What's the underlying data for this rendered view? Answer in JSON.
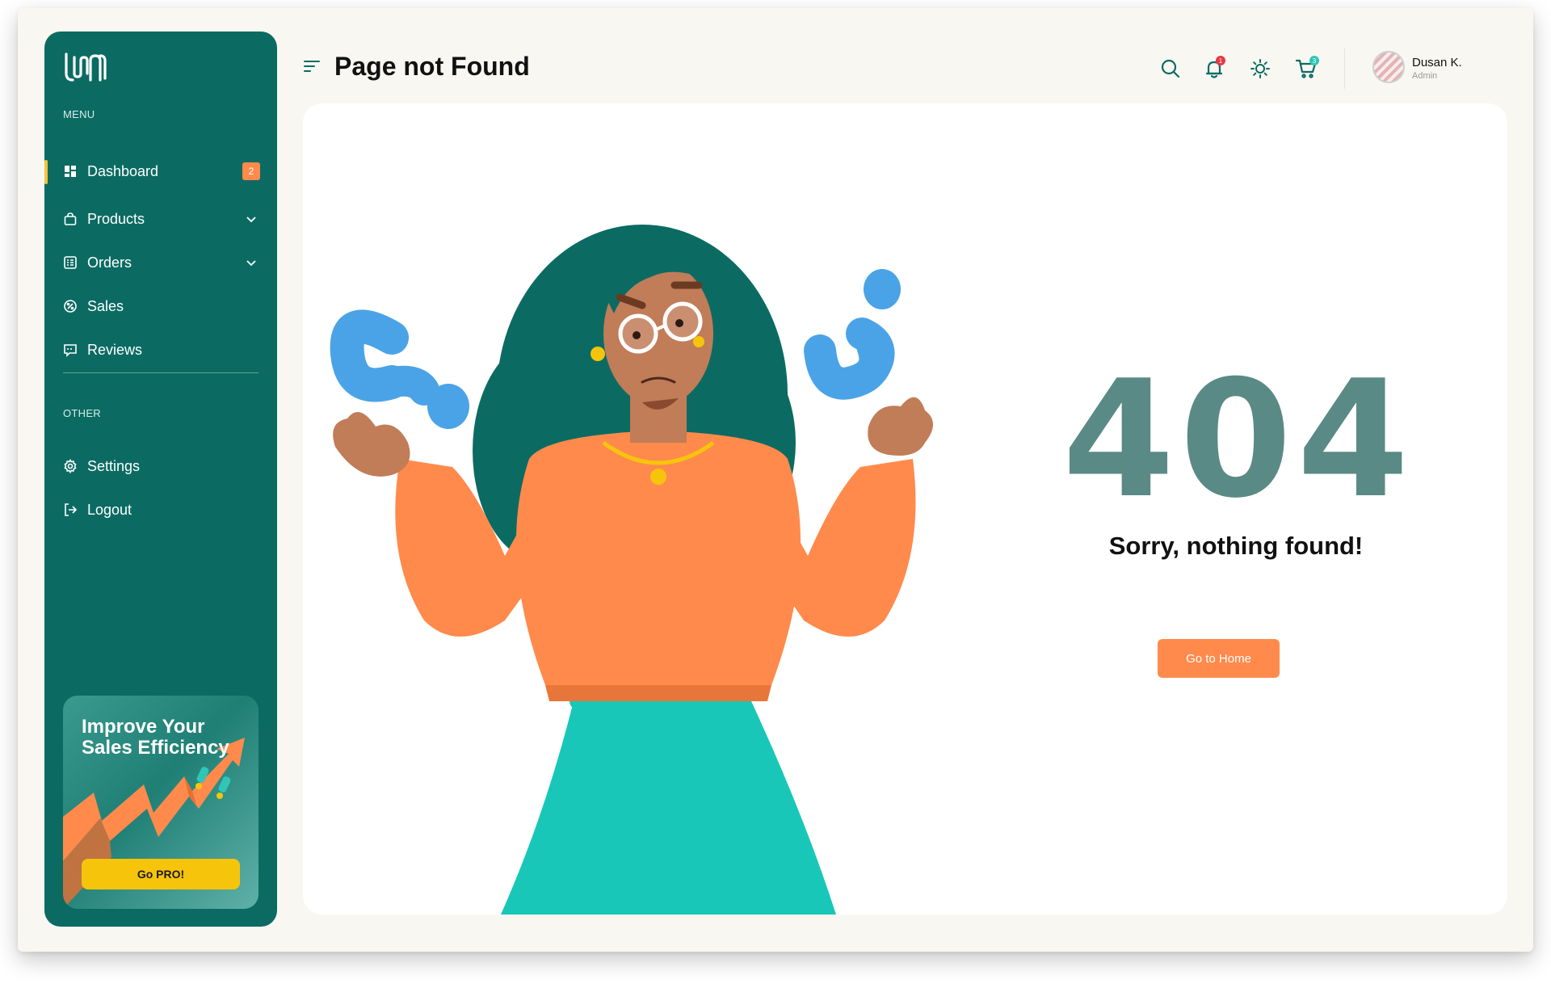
{
  "app": {
    "logo_text": "UOAN"
  },
  "sidebar": {
    "menu_label": "MENU",
    "other_label": "OTHER",
    "items": [
      {
        "label": "Dashboard",
        "icon": "dashboard-icon",
        "badge": "2",
        "active": true
      },
      {
        "label": "Products",
        "icon": "bag-icon",
        "expandable": true
      },
      {
        "label": "Orders",
        "icon": "orders-icon",
        "expandable": true
      },
      {
        "label": "Sales",
        "icon": "sales-icon"
      },
      {
        "label": "Reviews",
        "icon": "reviews-icon"
      }
    ],
    "other_items": [
      {
        "label": "Settings",
        "icon": "gear-icon"
      },
      {
        "label": "Logout",
        "icon": "logout-icon"
      }
    ],
    "promo": {
      "title": "Improve Your Sales Efficiency",
      "button_label": "Go PRO!"
    }
  },
  "header": {
    "title": "Page not Found",
    "notifications_count": "1",
    "cart_count": "3",
    "user": {
      "name": "Dusan K.",
      "role": "Admin"
    }
  },
  "main": {
    "error_code": "404",
    "message": "Sorry, nothing found!",
    "home_button_label": "Go to Home"
  },
  "colors": {
    "sidebar": "#0b6b63",
    "accent": "#ff8a4c",
    "pro_button": "#f7c40c",
    "error_code": "#5a8a85",
    "background": "#f8f7f1"
  }
}
